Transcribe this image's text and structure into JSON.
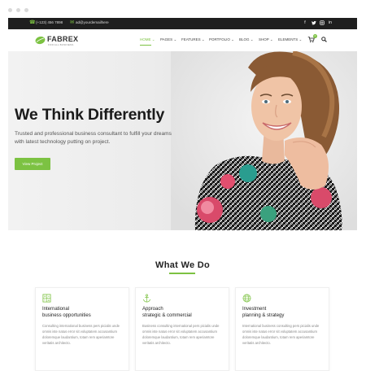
{
  "topbar": {
    "phone": "(+123) 456 7898",
    "email": "ad@yourdemailhere",
    "social": [
      "f",
      "t",
      "ig",
      "in"
    ]
  },
  "brand": {
    "name": "FABREX",
    "tagline": "FOR ALL BUSINESS",
    "accent": "#7cc242"
  },
  "nav": {
    "items": [
      "HOME",
      "PAGES",
      "FEATURES",
      "PORTFOLIO",
      "BLOG",
      "SHOP",
      "ELEMENTS"
    ],
    "active_index": 0,
    "cart_count": "0"
  },
  "hero": {
    "title": "We Think Differently",
    "subtitle": "Trusted and professional business consultant to fulfill your dreams with latest technology putting on project.",
    "button": "View Project"
  },
  "services": {
    "title": "What We Do",
    "cards": [
      {
        "icon": "calculator-icon",
        "title_line1": "International",
        "title_line2": "business opportunities",
        "text": "Consulting international business pers picialis unde omnis iste natus error sit voluptatem accusantium doloremque laudantium, totam rem aperiamtore veritatis architecto."
      },
      {
        "icon": "anchor-icon",
        "title_line1": "Approach",
        "title_line2": "strategic & commercial",
        "text": "Business consulting international pers picialis unde omnis iste natus error sit voluptatem accusantium doloremque laudantium, totam rem aperiamtore veritatis architecto."
      },
      {
        "icon": "globe-icon",
        "title_line1": "Investment",
        "title_line2": "planning & strategy",
        "text": "International business consulting pers picialis unde omnis iste natus error sit voluptatem accusantium doloremque laudantium, totam rem aperiamtore veritatis architecto."
      }
    ]
  }
}
